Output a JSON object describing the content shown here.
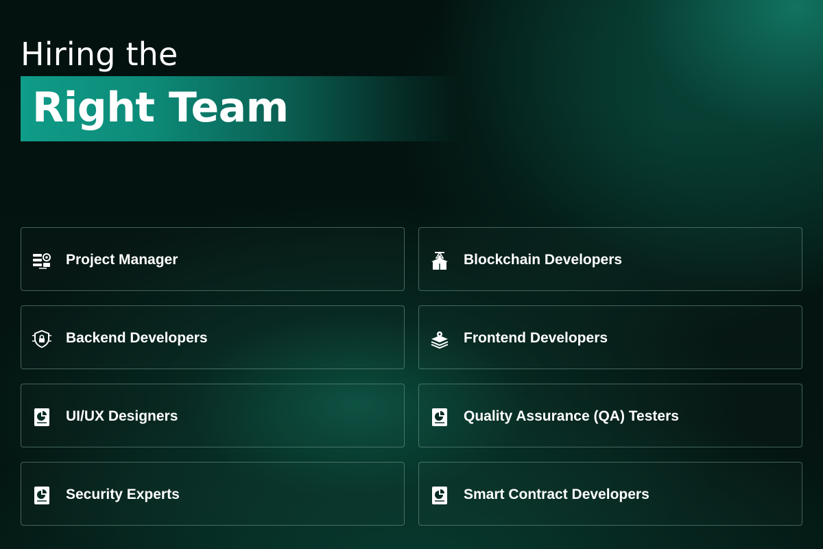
{
  "heading": {
    "line1": "Hiring the",
    "line2": "Right Team"
  },
  "roles": [
    {
      "label": "Project Manager",
      "icon": "project-manager-icon"
    },
    {
      "label": "Blockchain Developers",
      "icon": "blockchain-box-icon"
    },
    {
      "label": "Backend Developers",
      "icon": "security-shield-lock-icon"
    },
    {
      "label": "Frontend Developers",
      "icon": "layers-gear-icon"
    },
    {
      "label": "UI/UX Designers",
      "icon": "report-chart-icon"
    },
    {
      "label": "Quality Assurance (QA) Testers",
      "icon": "report-chart-icon"
    },
    {
      "label": "Security Experts",
      "icon": "report-chart-icon"
    },
    {
      "label": "Smart Contract Developers",
      "icon": "report-chart-icon"
    }
  ],
  "colors": {
    "accent": "#0f9c88",
    "background": "#03100d",
    "card_border": "#78a096"
  }
}
